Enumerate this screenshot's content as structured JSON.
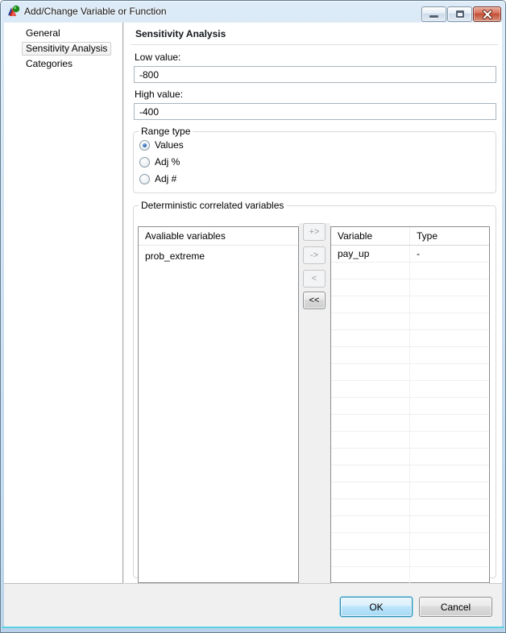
{
  "window": {
    "title": "Add/Change Variable or Function",
    "controls": {
      "minimize": "minimize",
      "maximize": "maximize",
      "close": "close"
    }
  },
  "sidebar": {
    "items": [
      {
        "label": "General",
        "selected": false
      },
      {
        "label": "Sensitivity Analysis",
        "selected": true
      },
      {
        "label": "Categories",
        "selected": false
      }
    ]
  },
  "main": {
    "heading": "Sensitivity Analysis",
    "low_value": {
      "label": "Low value:",
      "value": "-800"
    },
    "high_value": {
      "label": "High value:",
      "value": "-400"
    },
    "range_type": {
      "legend": "Range type",
      "options": [
        {
          "label": "Values",
          "selected": true
        },
        {
          "label": "Adj %",
          "selected": false
        },
        {
          "label": "Adj #",
          "selected": false
        }
      ]
    },
    "correlated": {
      "legend": "Deterministic correlated variables",
      "available": {
        "header": "Avaliable variables",
        "items": [
          "prob_extreme"
        ]
      },
      "transfer_buttons": [
        {
          "label": "+>",
          "enabled": false
        },
        {
          "label": "->",
          "enabled": false
        },
        {
          "label": "<",
          "enabled": false
        },
        {
          "label": "<<",
          "enabled": true
        }
      ],
      "selected_table": {
        "columns": [
          "Variable",
          "Type"
        ],
        "rows": [
          [
            "pay_up",
            "-"
          ]
        ],
        "empty_row_count": 19
      }
    }
  },
  "footer": {
    "ok_label": "OK",
    "cancel_label": "Cancel"
  },
  "colors": {
    "titlebar_top": "#dcebf7",
    "titlebar_bottom": "#b9d2ea",
    "frame_accent_cyan": "#49d5e4",
    "close_button_red": "#c24a31",
    "ok_border_blue": "#2d8bad",
    "radio_dot_blue": "#2c67b0",
    "panel_bg": "#ffffff",
    "footer_bg": "#f0f0f0"
  }
}
